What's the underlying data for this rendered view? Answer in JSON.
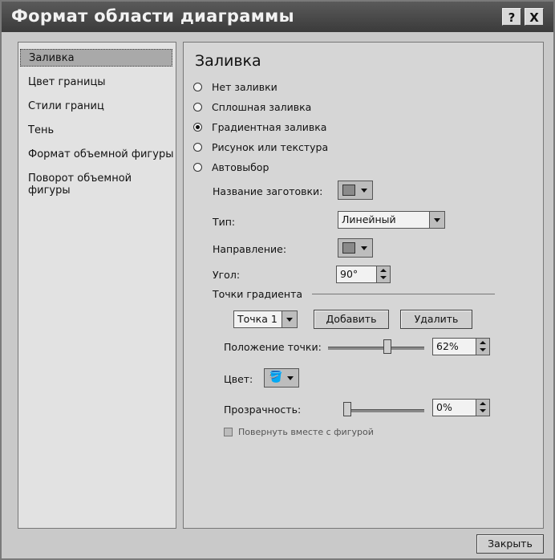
{
  "window": {
    "title": "Формат области диаграммы",
    "help_label": "?",
    "close_label": "X"
  },
  "sidebar": {
    "items": [
      {
        "label": "Заливка",
        "selected": true
      },
      {
        "label": "Цвет границы"
      },
      {
        "label": "Стили границ"
      },
      {
        "label": "Тень"
      },
      {
        "label": "Формат объемной фигуры"
      },
      {
        "label": "Поворот объемной фигуры"
      }
    ]
  },
  "panel": {
    "title": "Заливка",
    "fill_options": [
      {
        "label": "Нет заливки",
        "checked": false
      },
      {
        "label": "Сплошная заливка",
        "checked": false
      },
      {
        "label": "Градиентная заливка",
        "checked": true
      },
      {
        "label": "Рисунок или текстура",
        "checked": false
      },
      {
        "label": "Автовыбор",
        "checked": false
      }
    ],
    "preset_label": "Название заготовки:",
    "type_label": "Тип:",
    "type_value": "Линейный",
    "direction_label": "Направление:",
    "angle_label": "Угол:",
    "angle_value": "90°",
    "stops_group_label": "Точки градиента",
    "stop_value": "Точка 1",
    "add_button": "Добавить",
    "remove_button": "Удалить",
    "stop_position_label": "Положение точки:",
    "stop_position_value": "62%",
    "stop_position_fraction": 0.62,
    "color_label": "Цвет:",
    "transparency_label": "Прозрачность:",
    "transparency_value": "0%",
    "transparency_fraction": 0.0,
    "rotate_with_shape_label": "Повернуть вместе с фигурой"
  },
  "footer": {
    "close_button": "Закрыть"
  },
  "colors": {
    "titlebar": "#3b3b3b",
    "dialog_bg": "#c9c9c9",
    "selected_item": "#a9a9a9"
  }
}
